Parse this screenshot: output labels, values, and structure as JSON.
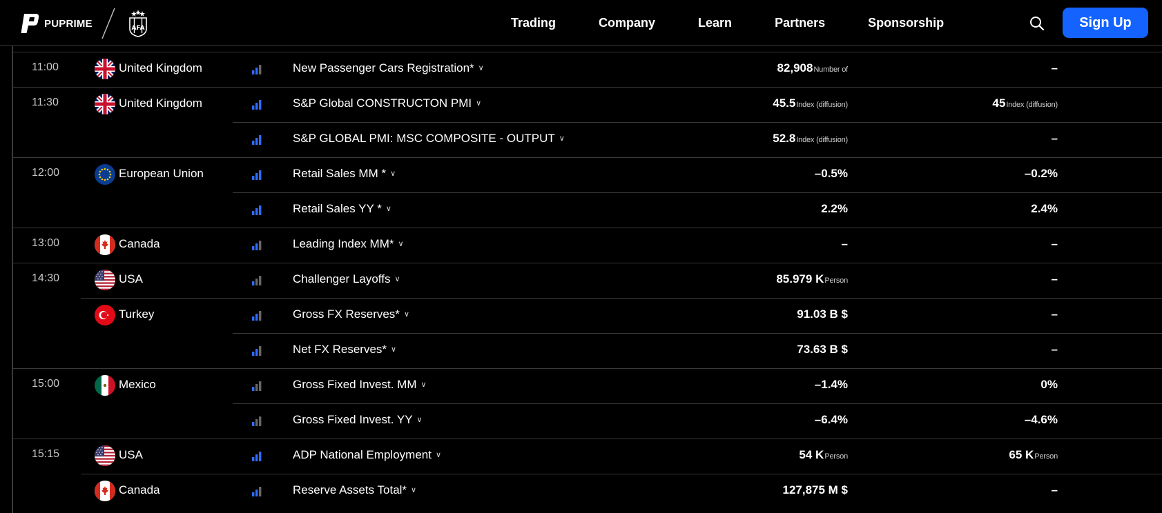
{
  "header": {
    "logo_text": "PUPRIME",
    "nav": [
      "Trading",
      "Company",
      "Learn",
      "Partners",
      "Sponsorship"
    ],
    "signup_label": "Sign Up",
    "brand_color": "#1463ff"
  },
  "impact_colors": {
    "active": "#2f6bff",
    "inactive": "#666666"
  },
  "rows": [
    {
      "time": "11:00",
      "country": "United Kingdom",
      "flag": "uk",
      "event": "New Passenger Cars Registration*",
      "prev_num": "82,908",
      "prev_unit": "Number of",
      "fore_num": "–",
      "fore_unit": "",
      "impact": 2
    },
    {
      "time": "11:30",
      "country": "United Kingdom",
      "flag": "uk",
      "event": "S&P Global CONSTRUCTON PMI",
      "prev_num": "45.5",
      "prev_unit": "Index (diffusion)",
      "fore_num": "45",
      "fore_unit": "Index (diffusion)",
      "impact": 3
    },
    {
      "time": "",
      "country": "",
      "flag": "",
      "event": "S&P GLOBAL PMI: MSC COMPOSITE - OUTPUT",
      "prev_num": "52.8",
      "prev_unit": "Index (diffusion)",
      "fore_num": "–",
      "fore_unit": "",
      "impact": 3
    },
    {
      "time": "12:00",
      "country": "European Union",
      "flag": "eu",
      "event": "Retail Sales MM *",
      "prev_num": "–0.5%",
      "prev_unit": "",
      "fore_num": "–0.2%",
      "fore_unit": "",
      "impact": 3
    },
    {
      "time": "",
      "country": "",
      "flag": "",
      "event": "Retail Sales YY *",
      "prev_num": "2.2%",
      "prev_unit": "",
      "fore_num": "2.4%",
      "fore_unit": "",
      "impact": 3
    },
    {
      "time": "13:00",
      "country": "Canada",
      "flag": "ca",
      "event": "Leading Index MM*",
      "prev_num": "–",
      "prev_unit": "",
      "fore_num": "–",
      "fore_unit": "",
      "impact": 2
    },
    {
      "time": "14:30",
      "country": "USA",
      "flag": "us",
      "event": "Challenger Layoffs",
      "prev_num": "85.979 K",
      "prev_unit": "Person",
      "fore_num": "–",
      "fore_unit": "",
      "impact": 1
    },
    {
      "time": "",
      "country": "Turkey",
      "flag": "tr",
      "event": "Gross FX Reserves*",
      "prev_num": "91.03 B $",
      "prev_unit": "",
      "fore_num": "–",
      "fore_unit": "",
      "impact": 2
    },
    {
      "time": "",
      "country": "",
      "flag": "",
      "event": "Net FX Reserves*",
      "prev_num": "73.63 B $",
      "prev_unit": "",
      "fore_num": "–",
      "fore_unit": "",
      "impact": 2
    },
    {
      "time": "15:00",
      "country": "Mexico",
      "flag": "mx",
      "event": "Gross Fixed Invest. MM",
      "prev_num": "–1.4%",
      "prev_unit": "",
      "fore_num": "0%",
      "fore_unit": "",
      "impact": 1
    },
    {
      "time": "",
      "country": "",
      "flag": "",
      "event": "Gross Fixed Invest. YY",
      "prev_num": "–6.4%",
      "prev_unit": "",
      "fore_num": "–4.6%",
      "fore_unit": "",
      "impact": 1
    },
    {
      "time": "15:15",
      "country": "USA",
      "flag": "us",
      "event": "ADP National Employment",
      "prev_num": "54 K",
      "prev_unit": "Person",
      "fore_num": "65 K",
      "fore_unit": "Person",
      "impact": 3
    },
    {
      "time": "",
      "country": "Canada",
      "flag": "ca",
      "event": "Reserve Assets Total*",
      "prev_num": "127,875 M $",
      "prev_unit": "",
      "fore_num": "–",
      "fore_unit": "",
      "impact": 2
    }
  ]
}
